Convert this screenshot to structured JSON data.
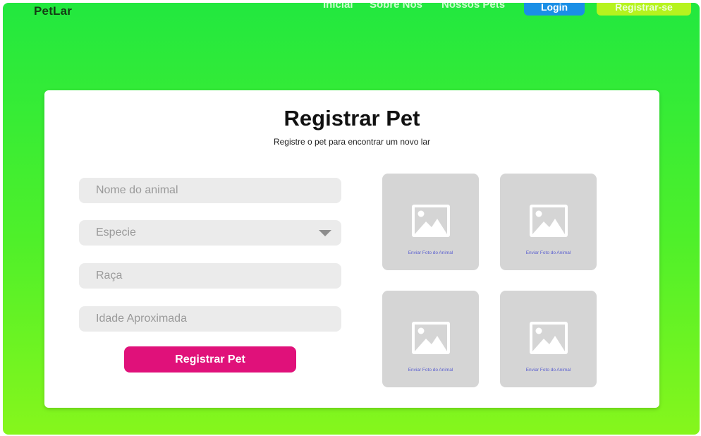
{
  "header": {
    "logo": "PetLar",
    "nav": [
      "Inicial",
      "Sobre Nos",
      "Nossos Pets"
    ],
    "login_label": "Login",
    "register_label": "Registrar-se"
  },
  "card": {
    "title": "Registrar Pet",
    "subtitle": "Registre o pet para encontrar um novo lar"
  },
  "form": {
    "name_placeholder": "Nome do animal",
    "species_value": "Especie",
    "breed_placeholder": "Raça",
    "age_placeholder": "Idade Aproximada",
    "submit_label": "Registrar Pet"
  },
  "photos": [
    {
      "label": "Enviar Foto do Animal"
    },
    {
      "label": "Enviar Foto do Animal"
    },
    {
      "label": "Enviar Foto do Animal"
    },
    {
      "label": "Enviar Foto do Animal"
    }
  ],
  "colors": {
    "accent": "#e0117a",
    "login_button": "#1a8fe6",
    "register_button": "#b6f31e",
    "background_top": "#22e83f",
    "background_bottom": "#86f61c"
  },
  "icons": {
    "photo": "image-placeholder-icon",
    "select": "chevron-down-icon"
  }
}
